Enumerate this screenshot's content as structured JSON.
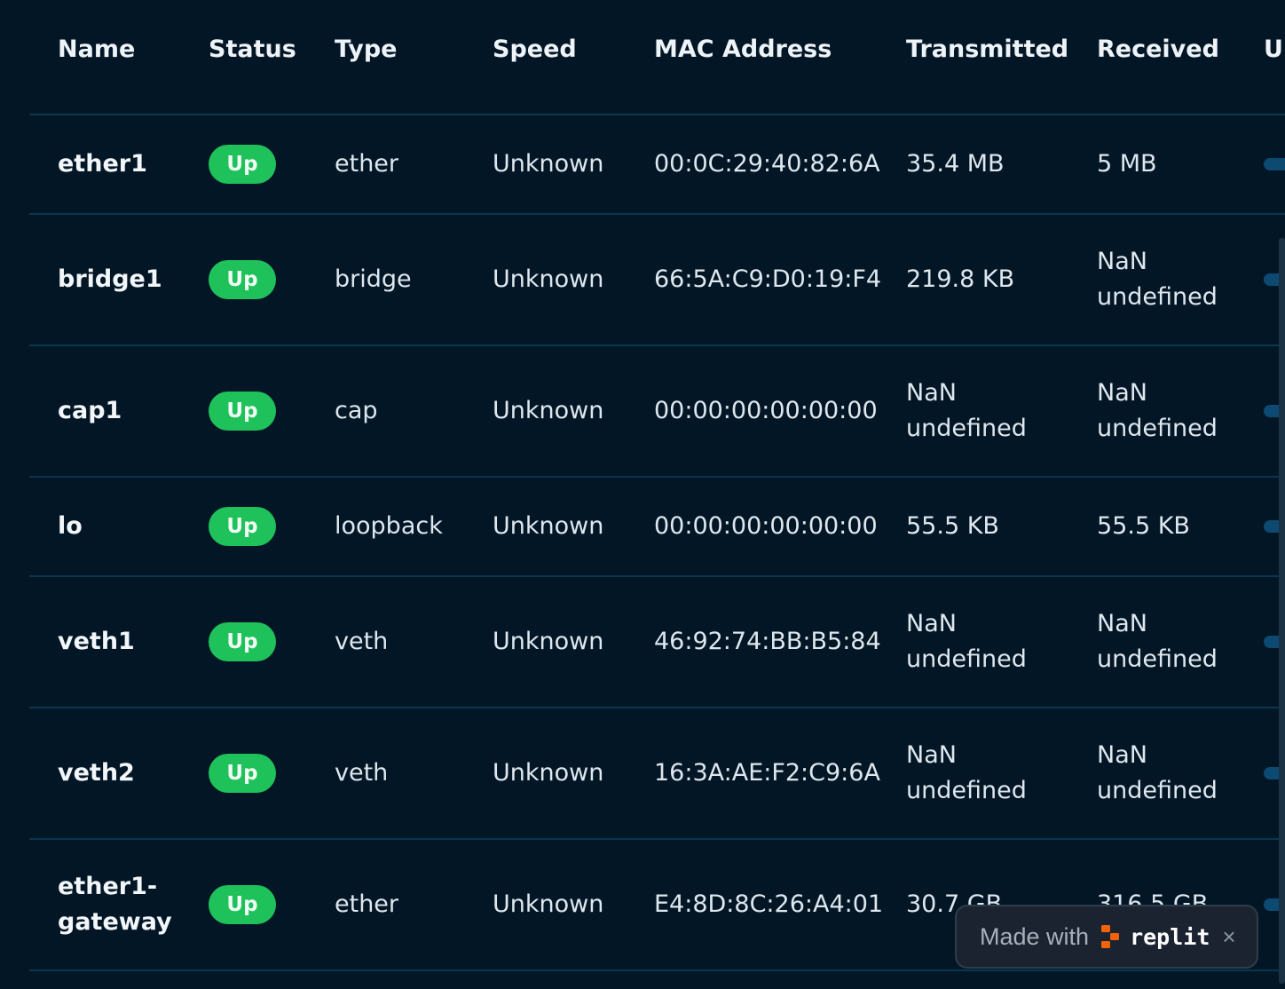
{
  "headers": {
    "name": "Name",
    "status": "Status",
    "type": "Type",
    "speed": "Speed",
    "mac": "MAC Address",
    "transmitted": "Transmitted",
    "received": "Received",
    "extra": "U"
  },
  "rows": [
    {
      "name": "ether1",
      "status": "Up",
      "type": "ether",
      "speed": "Unknown",
      "mac": "00:0C:29:40:82:6A",
      "tx": [
        "35.4 MB"
      ],
      "rx": [
        "5 MB"
      ]
    },
    {
      "name": "bridge1",
      "status": "Up",
      "type": "bridge",
      "speed": "Unknown",
      "mac": "66:5A:C9:D0:19:F4",
      "tx": [
        "219.8 KB"
      ],
      "rx": [
        "NaN",
        "undefined"
      ]
    },
    {
      "name": "cap1",
      "status": "Up",
      "type": "cap",
      "speed": "Unknown",
      "mac": "00:00:00:00:00:00",
      "tx": [
        "NaN",
        "undefined"
      ],
      "rx": [
        "NaN",
        "undefined"
      ]
    },
    {
      "name": "lo",
      "status": "Up",
      "type": "loopback",
      "speed": "Unknown",
      "mac": "00:00:00:00:00:00",
      "tx": [
        "55.5 KB"
      ],
      "rx": [
        "55.5 KB"
      ]
    },
    {
      "name": "veth1",
      "status": "Up",
      "type": "veth",
      "speed": "Unknown",
      "mac": "46:92:74:BB:B5:84",
      "tx": [
        "NaN",
        "undefined"
      ],
      "rx": [
        "NaN",
        "undefined"
      ]
    },
    {
      "name": "veth2",
      "status": "Up",
      "type": "veth",
      "speed": "Unknown",
      "mac": "16:3A:AE:F2:C9:6A",
      "tx": [
        "NaN",
        "undefined"
      ],
      "rx": [
        "NaN",
        "undefined"
      ]
    },
    {
      "name": "ether1-gateway",
      "name_lines": [
        "ether1-",
        "gateway"
      ],
      "status": "Up",
      "type": "ether",
      "speed": "Unknown",
      "mac": "E4:8D:8C:26:A4:01",
      "tx": [
        "30.7 GB"
      ],
      "rx": [
        "316.5 GB"
      ]
    }
  ],
  "toast": {
    "made_with": "Made with",
    "brand": "replit",
    "close": "×"
  },
  "colors": {
    "background": "#021626",
    "divider": "#0c3550",
    "status_up": "#1fc15a"
  }
}
